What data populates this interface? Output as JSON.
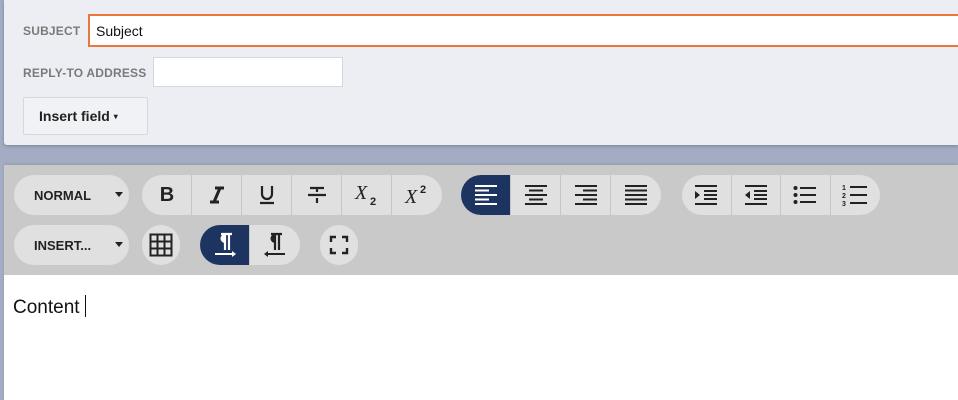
{
  "form": {
    "subject_label": "SUBJECT",
    "subject_value": "Subject",
    "reply_to_label": "REPLY-TO ADDRESS",
    "reply_to_value": "",
    "insert_field_label": "Insert field",
    "insert_field_caret": "▾"
  },
  "toolbar": {
    "format_dropdown": "NORMAL",
    "insert_dropdown": "INSERT...",
    "text_style_icons": [
      "bold-icon",
      "italic-icon",
      "underline-icon",
      "strikethrough-icon",
      "subscript-icon",
      "superscript-icon"
    ],
    "alignment_icons": [
      "align-left-icon",
      "align-center-icon",
      "align-right-icon",
      "align-justify-icon"
    ],
    "list_icons": [
      "indent-icon",
      "outdent-icon",
      "bullet-list-icon",
      "numbered-list-icon"
    ],
    "direction_icons": [
      "ltr-direction-icon",
      "rtl-direction-icon"
    ],
    "active_alignment": "left",
    "active_direction": "ltr"
  },
  "editor": {
    "content": "Content"
  },
  "colors": {
    "accent": "#e8773d",
    "active": "#1d3461",
    "toolbar_bg": "#c9c9c9",
    "button_bg": "#e0e0e0"
  }
}
